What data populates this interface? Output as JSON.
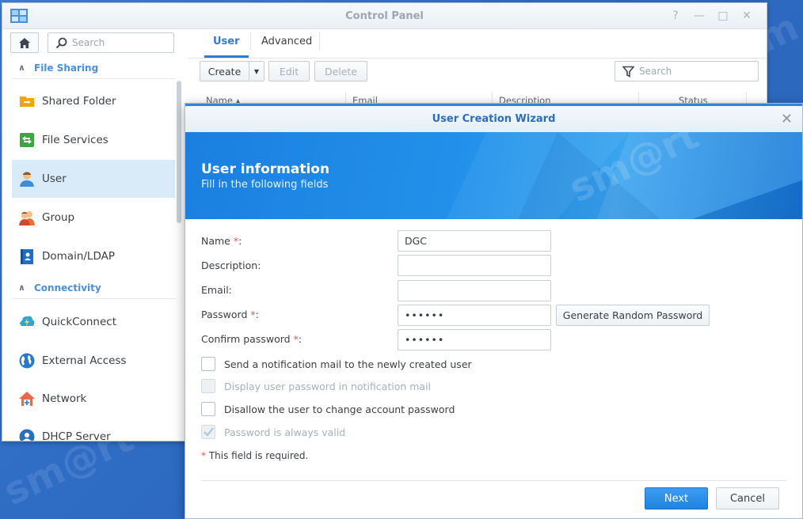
{
  "control_panel": {
    "title": "Control Panel",
    "window_controls": [
      "?",
      "—",
      "□",
      "✕"
    ]
  },
  "sidebar": {
    "search_placeholder": "Search",
    "sections": [
      {
        "label": "File Sharing"
      },
      {
        "label": "Connectivity"
      }
    ],
    "items": [
      {
        "label": "Shared Folder",
        "icon": "shared-folder-icon"
      },
      {
        "label": "File Services",
        "icon": "file-services-icon"
      },
      {
        "label": "User",
        "icon": "user-icon",
        "active": true
      },
      {
        "label": "Group",
        "icon": "group-icon"
      },
      {
        "label": "Domain/LDAP",
        "icon": "domain-ldap-icon"
      },
      {
        "label": "QuickConnect",
        "icon": "quickconnect-icon"
      },
      {
        "label": "External Access",
        "icon": "external-access-icon"
      },
      {
        "label": "Network",
        "icon": "network-icon"
      },
      {
        "label": "DHCP Server",
        "icon": "dhcp-server-icon"
      }
    ]
  },
  "main": {
    "tabs": [
      {
        "label": "User",
        "active": true
      },
      {
        "label": "Advanced"
      }
    ],
    "toolbar": {
      "create": "Create",
      "edit": "Edit",
      "delete": "Delete",
      "search_placeholder": "Search"
    },
    "columns": [
      "Name ▴",
      "Email",
      "Description",
      "Status"
    ]
  },
  "wizard": {
    "title": "User Creation Wizard",
    "heading": "User information",
    "subheading": "Fill in the following fields",
    "fields": {
      "name_label": "Name",
      "name_value": "DGC",
      "description_label": "Description:",
      "description_value": "",
      "email_label": "Email:",
      "email_value": "",
      "password_label": "Password",
      "password_value": "••••••",
      "confirm_label": "Confirm password",
      "confirm_value": "••••••",
      "required_marker": "*",
      "colon": ":"
    },
    "generate_password": "Generate Random Password",
    "checkboxes": [
      {
        "label": "Send a notification mail to the newly created user",
        "checked": false,
        "disabled": false
      },
      {
        "label": "Display user password in notification mail",
        "checked": false,
        "disabled": true
      },
      {
        "label": "Disallow the user to change account password",
        "checked": false,
        "disabled": false
      },
      {
        "label": "Password is always valid",
        "checked": true,
        "disabled": true
      }
    ],
    "required_note": "This field is required.",
    "next": "Next",
    "cancel": "Cancel"
  },
  "colors": {
    "accent": "#2f7ad2",
    "banner": "#1b7fe0",
    "required": "#e2554a"
  }
}
